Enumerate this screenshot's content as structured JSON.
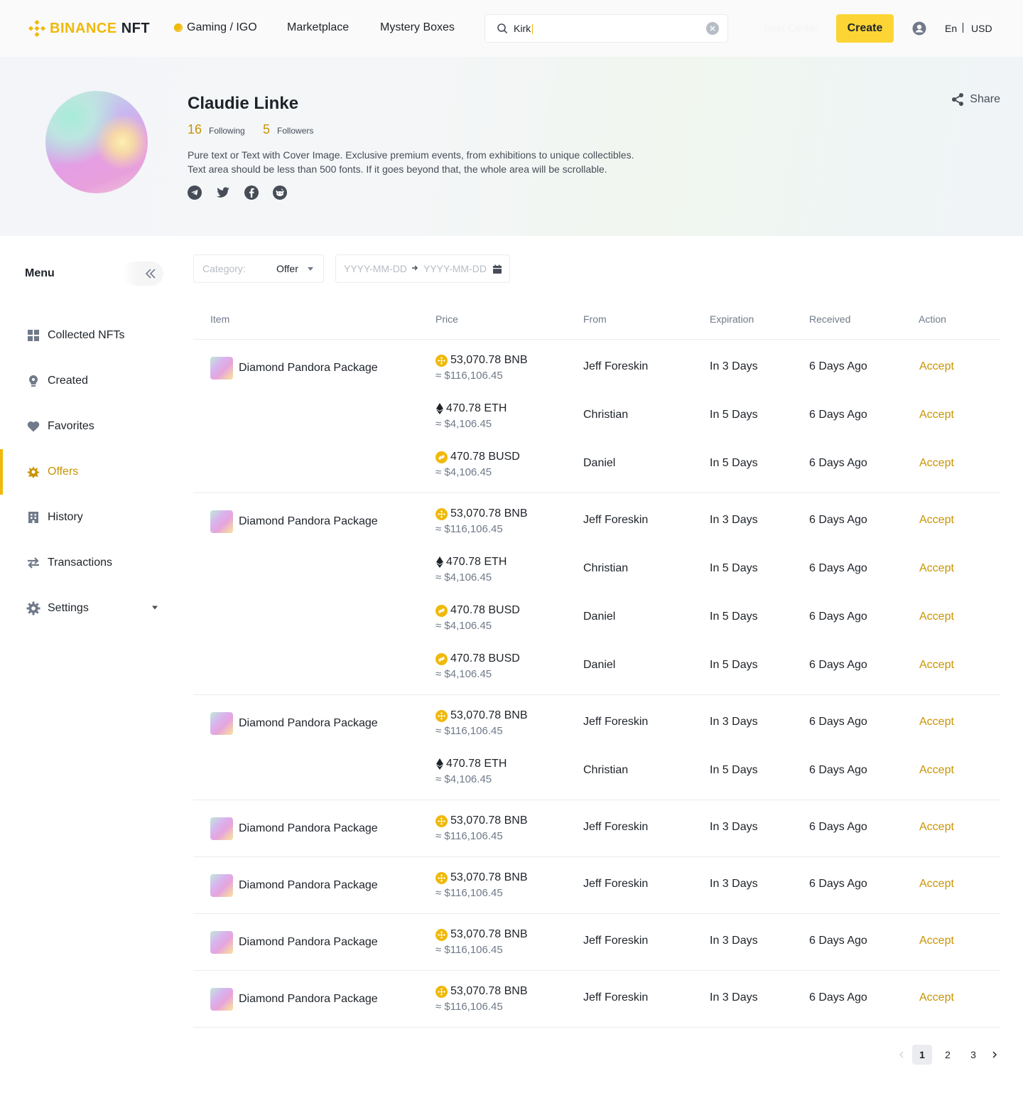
{
  "header": {
    "brand": "BINANCE",
    "brand_suffix": "NFT",
    "nav": [
      "Gaming / IGO",
      "Marketplace",
      "Mystery Boxes"
    ],
    "search_value": "Kirk",
    "user_center": "User Center",
    "create_label": "Create",
    "lang": "En",
    "currency": "USD"
  },
  "profile": {
    "name": "Claudie Linke",
    "following_count": "16",
    "following_label": "Following",
    "followers_count": "5",
    "followers_label": "Followers",
    "bio_line1": "Pure text or Text with Cover Image. Exclusive premium events, from exhibitions to unique collectibles.",
    "bio_line2": "Text area should be less than 500 fonts. If it goes beyond that, the whole area will be scrollable.",
    "socials": [
      "telegram-icon",
      "twitter-icon",
      "facebook-icon",
      "reddit-icon"
    ],
    "share_label": "Share"
  },
  "sidebar": {
    "title": "Menu",
    "items": [
      {
        "label": "Collected NFTs",
        "icon": "grid-icon"
      },
      {
        "label": "Created",
        "icon": "bulb-icon"
      },
      {
        "label": "Favorites",
        "icon": "heart-icon"
      },
      {
        "label": "Offers",
        "icon": "offer-icon",
        "active": true
      },
      {
        "label": "History",
        "icon": "building-icon"
      },
      {
        "label": "Transactions",
        "icon": "transfer-icon"
      },
      {
        "label": "Settings",
        "icon": "gear-icon"
      }
    ]
  },
  "filters": {
    "category_label": "Category:",
    "category_value": "Offer",
    "date_start_placeholder": "YYYY-MM-DD",
    "date_end_placeholder": "YYYY-MM-DD"
  },
  "table": {
    "headers": [
      "Item",
      "Price",
      "From",
      "Expiration",
      "Received",
      "Action"
    ],
    "groups": [
      {
        "item": "Diamond Pandora Package",
        "offers": [
          {
            "amount": "53,070.78 BNB",
            "coin": "BNB",
            "usd": "≈ $116,106.45",
            "from": "Jeff Foreskin",
            "expiration": "In 3 Days",
            "received": "6 Days Ago",
            "action": "Accept"
          },
          {
            "amount": "470.78 ETH",
            "coin": "ETH",
            "usd": "≈ $4,106.45",
            "from": "Christian",
            "expiration": "In 5 Days",
            "received": "6 Days Ago",
            "action": "Accept"
          },
          {
            "amount": "470.78 BUSD",
            "coin": "BUSD",
            "usd": "≈ $4,106.45",
            "from": "Daniel",
            "expiration": "In 5 Days",
            "received": "6 Days Ago",
            "action": "Accept"
          }
        ]
      },
      {
        "item": "Diamond Pandora Package",
        "offers": [
          {
            "amount": "53,070.78 BNB",
            "coin": "BNB",
            "usd": "≈ $116,106.45",
            "from": "Jeff Foreskin",
            "expiration": "In 3 Days",
            "received": "6 Days Ago",
            "action": "Accept"
          },
          {
            "amount": "470.78 ETH",
            "coin": "ETH",
            "usd": "≈ $4,106.45",
            "from": "Christian",
            "expiration": "In 5 Days",
            "received": "6 Days Ago",
            "action": "Accept"
          },
          {
            "amount": "470.78 BUSD",
            "coin": "BUSD",
            "usd": "≈ $4,106.45",
            "from": "Daniel",
            "expiration": "In 5 Days",
            "received": "6 Days Ago",
            "action": "Accept"
          },
          {
            "amount": "470.78 BUSD",
            "coin": "BUSD",
            "usd": "≈ $4,106.45",
            "from": "Daniel",
            "expiration": "In 5 Days",
            "received": "6 Days Ago",
            "action": "Accept"
          }
        ]
      },
      {
        "item": "Diamond Pandora Package",
        "offers": [
          {
            "amount": "53,070.78 BNB",
            "coin": "BNB",
            "usd": "≈ $116,106.45",
            "from": "Jeff Foreskin",
            "expiration": "In 3 Days",
            "received": "6 Days Ago",
            "action": "Accept"
          },
          {
            "amount": "470.78 ETH",
            "coin": "ETH",
            "usd": "≈ $4,106.45",
            "from": "Christian",
            "expiration": "In 5 Days",
            "received": "6 Days Ago",
            "action": "Accept"
          }
        ]
      },
      {
        "item": "Diamond Pandora Package",
        "offers": [
          {
            "amount": "53,070.78 BNB",
            "coin": "BNB",
            "usd": "≈ $116,106.45",
            "from": "Jeff Foreskin",
            "expiration": "In 3 Days",
            "received": "6 Days Ago",
            "action": "Accept"
          }
        ]
      },
      {
        "item": "Diamond Pandora Package",
        "offers": [
          {
            "amount": "53,070.78 BNB",
            "coin": "BNB",
            "usd": "≈ $116,106.45",
            "from": "Jeff Foreskin",
            "expiration": "In 3 Days",
            "received": "6 Days Ago",
            "action": "Accept"
          }
        ]
      },
      {
        "item": "Diamond Pandora Package",
        "offers": [
          {
            "amount": "53,070.78 BNB",
            "coin": "BNB",
            "usd": "≈ $116,106.45",
            "from": "Jeff Foreskin",
            "expiration": "In 3 Days",
            "received": "6 Days Ago",
            "action": "Accept"
          }
        ]
      },
      {
        "item": "Diamond Pandora Package",
        "offers": [
          {
            "amount": "53,070.78 BNB",
            "coin": "BNB",
            "usd": "≈ $116,106.45",
            "from": "Jeff Foreskin",
            "expiration": "In 3 Days",
            "received": "6 Days Ago",
            "action": "Accept"
          }
        ]
      }
    ]
  },
  "pagination": {
    "pages": [
      "1",
      "2",
      "3"
    ],
    "current": "1"
  },
  "colors": {
    "accent": "#F0B90B",
    "accent_text": "#C99400",
    "create_button": "#FCD535"
  }
}
